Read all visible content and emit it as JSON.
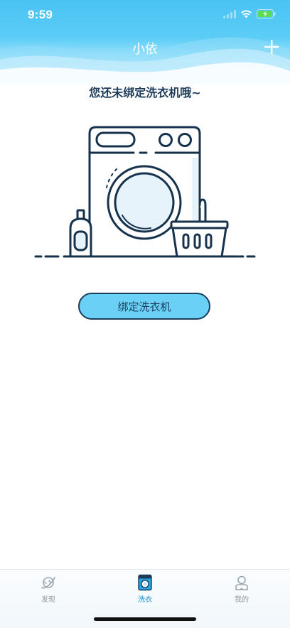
{
  "status_bar": {
    "time": "9:59"
  },
  "nav": {
    "title": "小依",
    "add_icon": "plus-icon"
  },
  "empty_state": {
    "message": "您还未绑定洗衣机哦~",
    "illustration": "washing-machine-illustration"
  },
  "bind_button": {
    "label": "绑定洗衣机"
  },
  "tab_bar": {
    "items": [
      {
        "label": "发现",
        "icon": "planet-icon",
        "active": false
      },
      {
        "label": "洗衣",
        "icon": "washing-machine-icon",
        "active": true
      },
      {
        "label": "我的",
        "icon": "user-icon",
        "active": false
      }
    ]
  },
  "colors": {
    "header_blue": "#49c2f3",
    "button_fill": "#6ad0f6",
    "outline_navy": "#1b3c5a",
    "active_tab": "#1f8fd6",
    "inactive_tab": "#8a98a3",
    "battery_green": "#5ddc5a"
  }
}
